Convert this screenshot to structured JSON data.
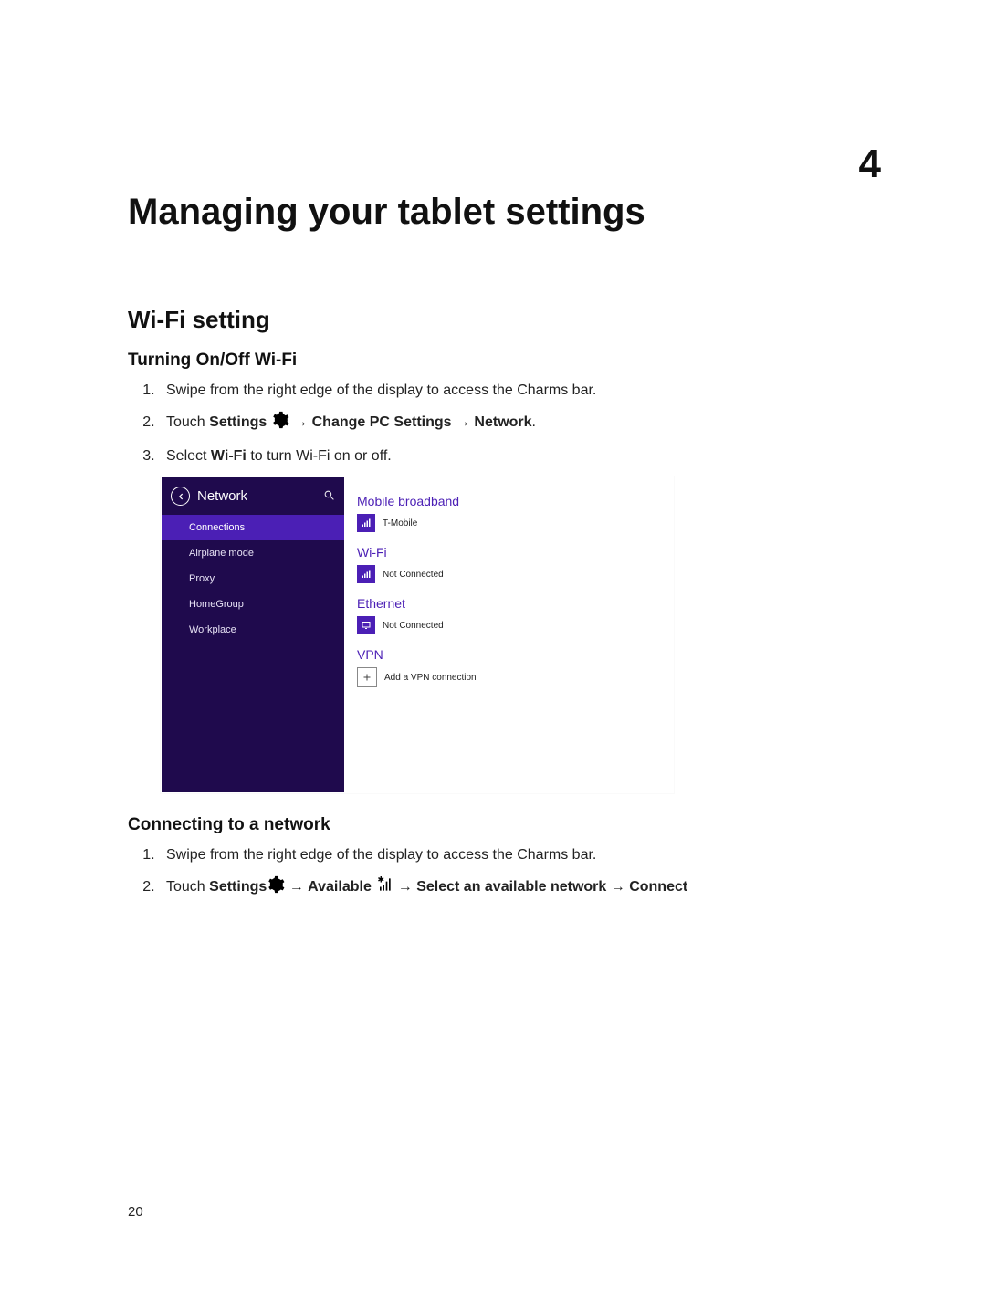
{
  "chapter": {
    "number": "4",
    "title": "Managing your tablet settings"
  },
  "wifi": {
    "heading": "Wi-Fi setting",
    "sub1": "Turning On/Off Wi-Fi",
    "steps1": {
      "s1": "Swipe from the right edge of the display to access the Charms bar.",
      "s2_touch": "Touch ",
      "s2_settings": "Settings",
      "s2_arrow1": " → ",
      "s2_change": "Change PC Settings",
      "s2_arrow2": " → ",
      "s2_network": "Network",
      "s2_end": ".",
      "s3_pre": "Select ",
      "s3_wifi": "Wi-Fi",
      "s3_post": " to turn Wi-Fi on or off."
    },
    "sub2": "Connecting to a network",
    "steps2": {
      "s1": "Swipe from the right edge of the display to access the Charms bar.",
      "s2_touch": "Touch ",
      "s2_settings": "Settings",
      "s2_arrow1": " → ",
      "s2_available": "Available",
      "s2_arrow2": " → ",
      "s2_select": "Select an available network",
      "s2_arrow3": " → ",
      "s2_connect": "Connect"
    }
  },
  "screenshot": {
    "nav": {
      "title": "Network",
      "items": [
        "Connections",
        "Airplane mode",
        "Proxy",
        "HomeGroup",
        "Workplace"
      ],
      "selected_index": 0
    },
    "content": {
      "mobile_heading": "Mobile broadband",
      "mobile_label": "T-Mobile",
      "wifi_heading": "Wi-Fi",
      "wifi_label": "Not Connected",
      "ethernet_heading": "Ethernet",
      "ethernet_label": "Not Connected",
      "vpn_heading": "VPN",
      "vpn_label": "Add a VPN connection"
    }
  },
  "page_number": "20"
}
